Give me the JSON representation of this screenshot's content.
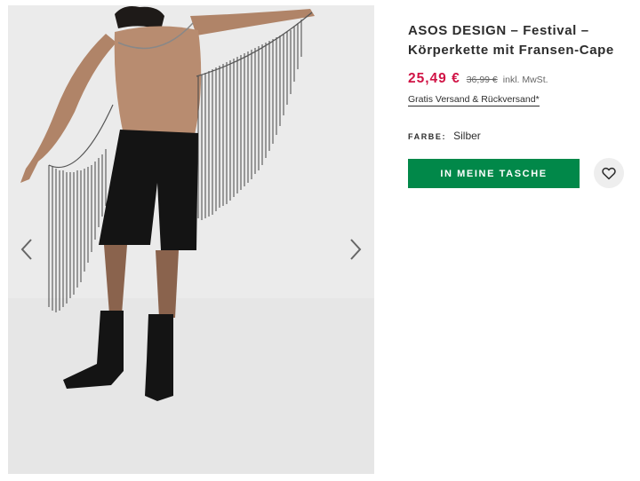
{
  "product": {
    "title": "ASOS DESIGN – Festival – Körperkette mit Fransen-Cape",
    "price_current": "25,49 €",
    "price_old": "36,99 €",
    "price_tax_note": "inkl. MwSt.",
    "shipping_link": "Gratis Versand & Rückversand*",
    "color_label": "FARBE:",
    "color_value": "Silber"
  },
  "actions": {
    "add_to_bag": "IN MEINE TASCHE"
  },
  "gallery": {
    "prev_icon": "chevron-left-icon",
    "next_icon": "chevron-right-icon",
    "background": "#ebebeb"
  },
  "colors": {
    "price_sale": "#d01345",
    "button_green": "#018849",
    "wishlist_bg": "#eeeeee"
  },
  "icons": {
    "wishlist": "heart-icon"
  }
}
